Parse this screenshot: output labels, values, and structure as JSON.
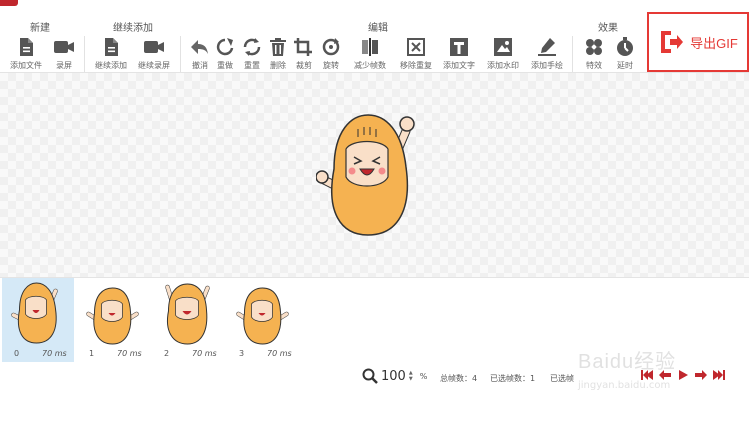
{
  "ribbon": {
    "groups": [
      {
        "label": "新建"
      },
      {
        "label": "继续添加"
      },
      {
        "label": "编辑"
      },
      {
        "label": "效果"
      }
    ],
    "tools": [
      {
        "label": "添加文件",
        "icon": "add-file-icon"
      },
      {
        "label": "录屏",
        "icon": "video-camera-icon"
      },
      {
        "label": "继续添加",
        "icon": "add-file-icon"
      },
      {
        "label": "继续录屏",
        "icon": "video-camera-icon"
      },
      {
        "label": "撤消",
        "icon": "undo-icon"
      },
      {
        "label": "重做",
        "icon": "redo-icon"
      },
      {
        "label": "重置",
        "icon": "reset-icon"
      },
      {
        "label": "删除",
        "icon": "trash-icon"
      },
      {
        "label": "裁剪",
        "icon": "crop-icon"
      },
      {
        "label": "旋转",
        "icon": "rotate-icon"
      },
      {
        "label": "减少帧数",
        "icon": "reduce-frames-icon"
      },
      {
        "label": "移除重复",
        "icon": "remove-duplicates-icon"
      },
      {
        "label": "添加文字",
        "icon": "text-icon"
      },
      {
        "label": "添加水印",
        "icon": "watermark-icon"
      },
      {
        "label": "添加手绘",
        "icon": "draw-icon"
      },
      {
        "label": "特效",
        "icon": "effects-icon"
      },
      {
        "label": "延时",
        "icon": "timer-icon"
      }
    ],
    "export_label": "导出GIF"
  },
  "frames": [
    {
      "index": "0",
      "duration": "70 ms"
    },
    {
      "index": "1",
      "duration": "70 ms"
    },
    {
      "index": "2",
      "duration": "70 ms"
    },
    {
      "index": "3",
      "duration": "70 ms"
    }
  ],
  "status": {
    "zoom": "100",
    "zoom_unit": "%",
    "total_frames": "总帧数：4",
    "selected_frames": "已选帧数：1",
    "selected_frame_partial": "已选帧"
  },
  "watermark": {
    "line1": "Baidu经验",
    "line2": "jingyan.baidu.com"
  },
  "colors": {
    "accent": "#e53935",
    "brand": "#c0272d",
    "character": "#f5b251",
    "selected_frame": "#d5e9f7"
  }
}
